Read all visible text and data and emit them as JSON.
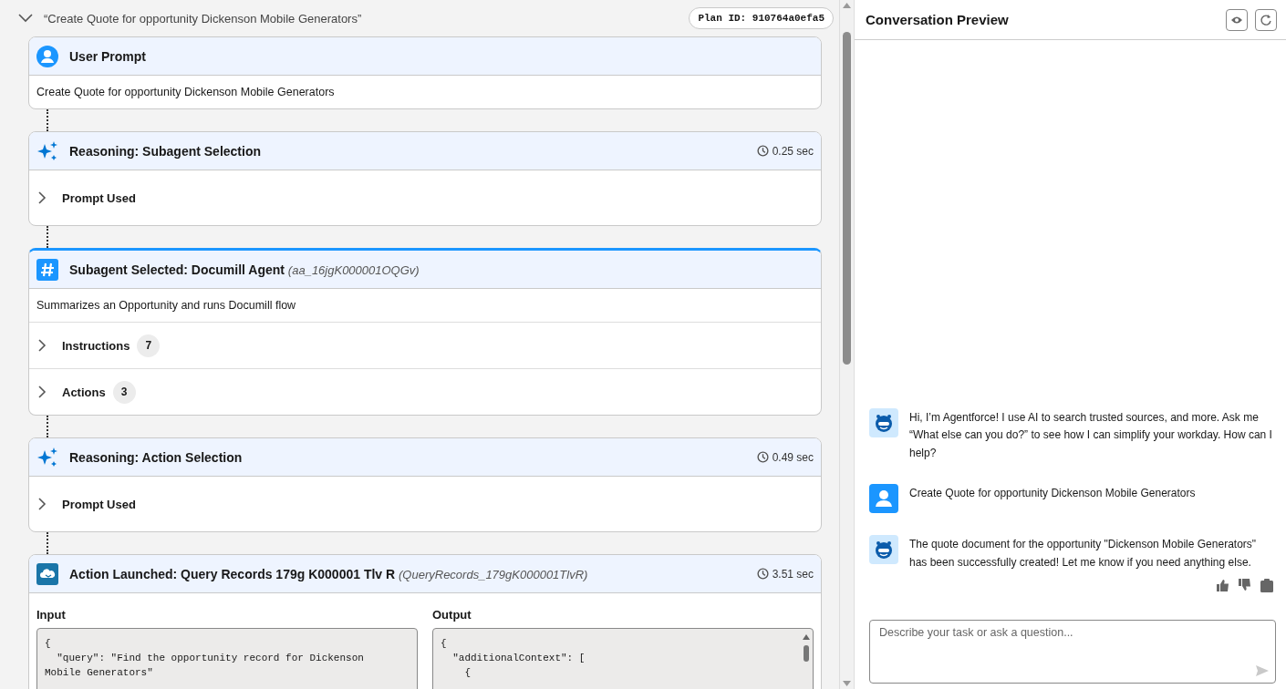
{
  "plan": {
    "title": "“Create Quote for opportunity Dickenson Mobile Generators”",
    "expanded": true,
    "plan_id": "Plan ID: 910764a0efa5",
    "steps": [
      {
        "kind": "user",
        "title": "User Prompt",
        "selected": false,
        "description": "Create Quote for opportunity Dickenson Mobile Generators"
      },
      {
        "kind": "reasoning",
        "title": "Reasoning: Subagent Selection",
        "selected": false,
        "duration": "0.25 sec",
        "rows": [
          {
            "label": "Prompt Used",
            "expanded": false
          }
        ]
      },
      {
        "kind": "subagent",
        "title": "Subagent Selected: Documill Agent",
        "subtitle": "(aa_16jgK000001OQGv)",
        "selected": true,
        "description": "Summarizes an Opportunity and runs Documill flow",
        "rows": [
          {
            "label": "Instructions",
            "count": "7",
            "expanded": false
          },
          {
            "label": "Actions",
            "count": "3",
            "expanded": false
          }
        ]
      },
      {
        "kind": "reasoning",
        "title": "Reasoning: Action Selection",
        "selected": false,
        "duration": "0.49 sec",
        "rows": [
          {
            "label": "Prompt Used",
            "expanded": false
          }
        ]
      },
      {
        "kind": "action",
        "title": "Action Launched: Query Records 179g K000001 Tlv R",
        "subtitle": "(QueryRecords_179gK000001TlvR)",
        "selected": false,
        "duration": "3.51 sec",
        "io": [
          {
            "label": "Input",
            "lines": [
              "{",
              "  \"query\": \"Find the opportunity record for Dickenson",
              "Mobile Generators\""
            ]
          },
          {
            "label": "Output",
            "lines": [
              "{",
              "  \"additionalContext\": [",
              "    {"
            ]
          }
        ]
      }
    ]
  },
  "preview": {
    "title": "Conversation Preview",
    "messages": [
      {
        "kind": "agent",
        "text": "Hi, I’m Agentforce! I use AI to search trusted sources, and more. Ask me “What else can you do?” to see how I can simplify your workday. How can I help?",
        "feedback": false
      },
      {
        "kind": "user",
        "text": "Create Quote for opportunity Dickenson Mobile Generators",
        "feedback": false
      },
      {
        "kind": "agent",
        "text": "The quote document for the opportunity \"Dickenson Mobile Generators\" has been successfully created! Let me know if you need anything else.",
        "feedback": true
      }
    ],
    "composer": {
      "placeholder": "Describe your task or ask a question..."
    }
  }
}
